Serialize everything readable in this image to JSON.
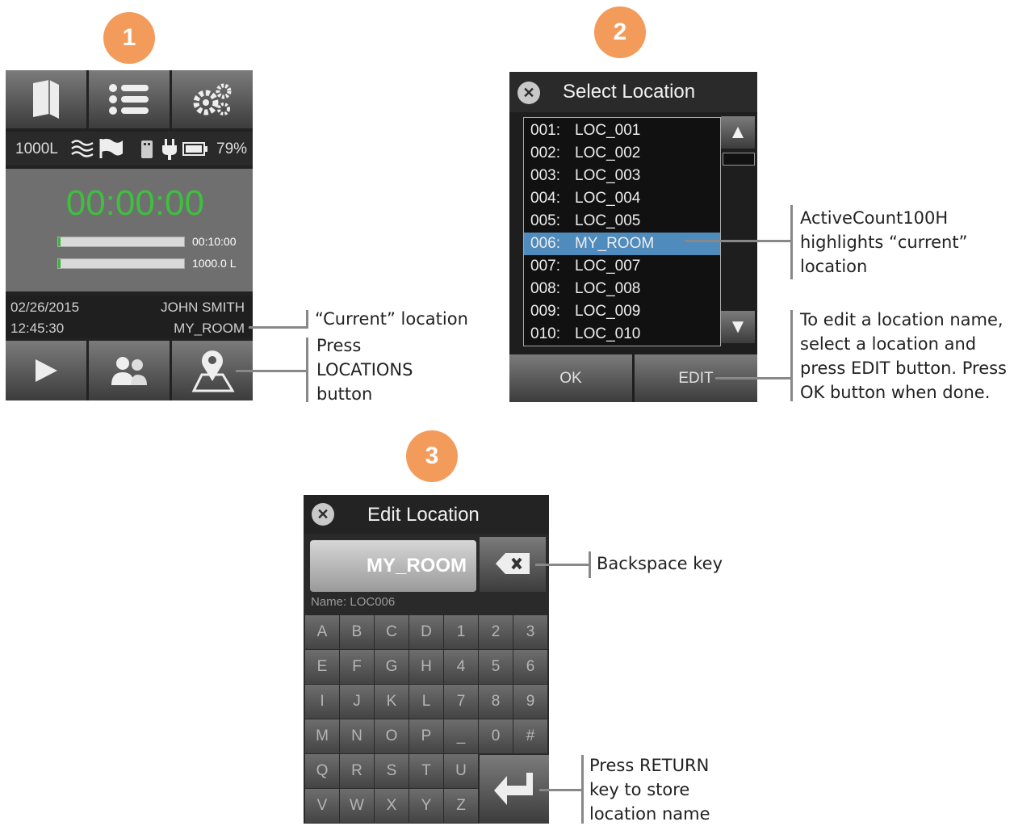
{
  "badges": [
    "1",
    "2",
    "3"
  ],
  "panel1": {
    "status": {
      "volume": "1000L",
      "battery": "79%"
    },
    "timer": "00:00:00",
    "bars": [
      {
        "label": "00:10:00",
        "progress": 0.02
      },
      {
        "label": "1000.0 L",
        "progress": 0.02
      }
    ],
    "info": {
      "date": "02/26/2015",
      "user": "JOHN SMITH",
      "time": "12:45:30",
      "location": "MY_ROOM"
    },
    "icons": {
      "top": [
        "book-icon",
        "list-icon",
        "gears-icon"
      ],
      "status": [
        "flow-icon",
        "flag-icon",
        "usb-icon",
        "plug-icon",
        "battery-icon"
      ],
      "bottom": [
        "play-icon",
        "users-icon",
        "map-pin-icon"
      ]
    }
  },
  "panel2": {
    "title": "Select Location",
    "locations": [
      {
        "num": "001:",
        "name": "LOC_001"
      },
      {
        "num": "002:",
        "name": "LOC_002"
      },
      {
        "num": "003:",
        "name": "LOC_003"
      },
      {
        "num": "004:",
        "name": "LOC_004"
      },
      {
        "num": "005:",
        "name": "LOC_005"
      },
      {
        "num": "006:",
        "name": "MY_ROOM",
        "selected": true
      },
      {
        "num": "007:",
        "name": "LOC_007"
      },
      {
        "num": "008:",
        "name": "LOC_008"
      },
      {
        "num": "009:",
        "name": "LOC_009"
      },
      {
        "num": "010:",
        "name": "LOC_010"
      }
    ],
    "ok_label": "OK",
    "edit_label": "EDIT",
    "selected_color": "#4f8bbd"
  },
  "panel3": {
    "title": "Edit Location",
    "field_value": "MY_ROOM",
    "name_label": "Name: LOC006",
    "keys": [
      [
        "A",
        "B",
        "C",
        "D",
        "1",
        "2",
        "3"
      ],
      [
        "E",
        "F",
        "G",
        "H",
        "4",
        "5",
        "6"
      ],
      [
        "I",
        "J",
        "K",
        "L",
        "7",
        "8",
        "9"
      ],
      [
        "M",
        "N",
        "O",
        "P",
        "_",
        "0",
        "#"
      ],
      [
        "Q",
        "R",
        "S",
        "T",
        "U"
      ],
      [
        "V",
        "W",
        "X",
        "Y",
        "Z"
      ]
    ]
  },
  "callouts": {
    "current_location": "“Current” location",
    "press_locations": [
      "Press",
      "LOCATIONS",
      "button"
    ],
    "highlights": [
      "ActiveCount100H",
      "highlights “current”",
      "location"
    ],
    "edit_instructions": [
      "To edit a location name,",
      "select a location and",
      "press EDIT button. Press",
      "OK button when done."
    ],
    "backspace": "Backspace key",
    "return": [
      "Press RETURN",
      "key to store",
      "location name"
    ]
  },
  "accent_color": "#f39b5a",
  "timer_color": "#3fbf3f"
}
